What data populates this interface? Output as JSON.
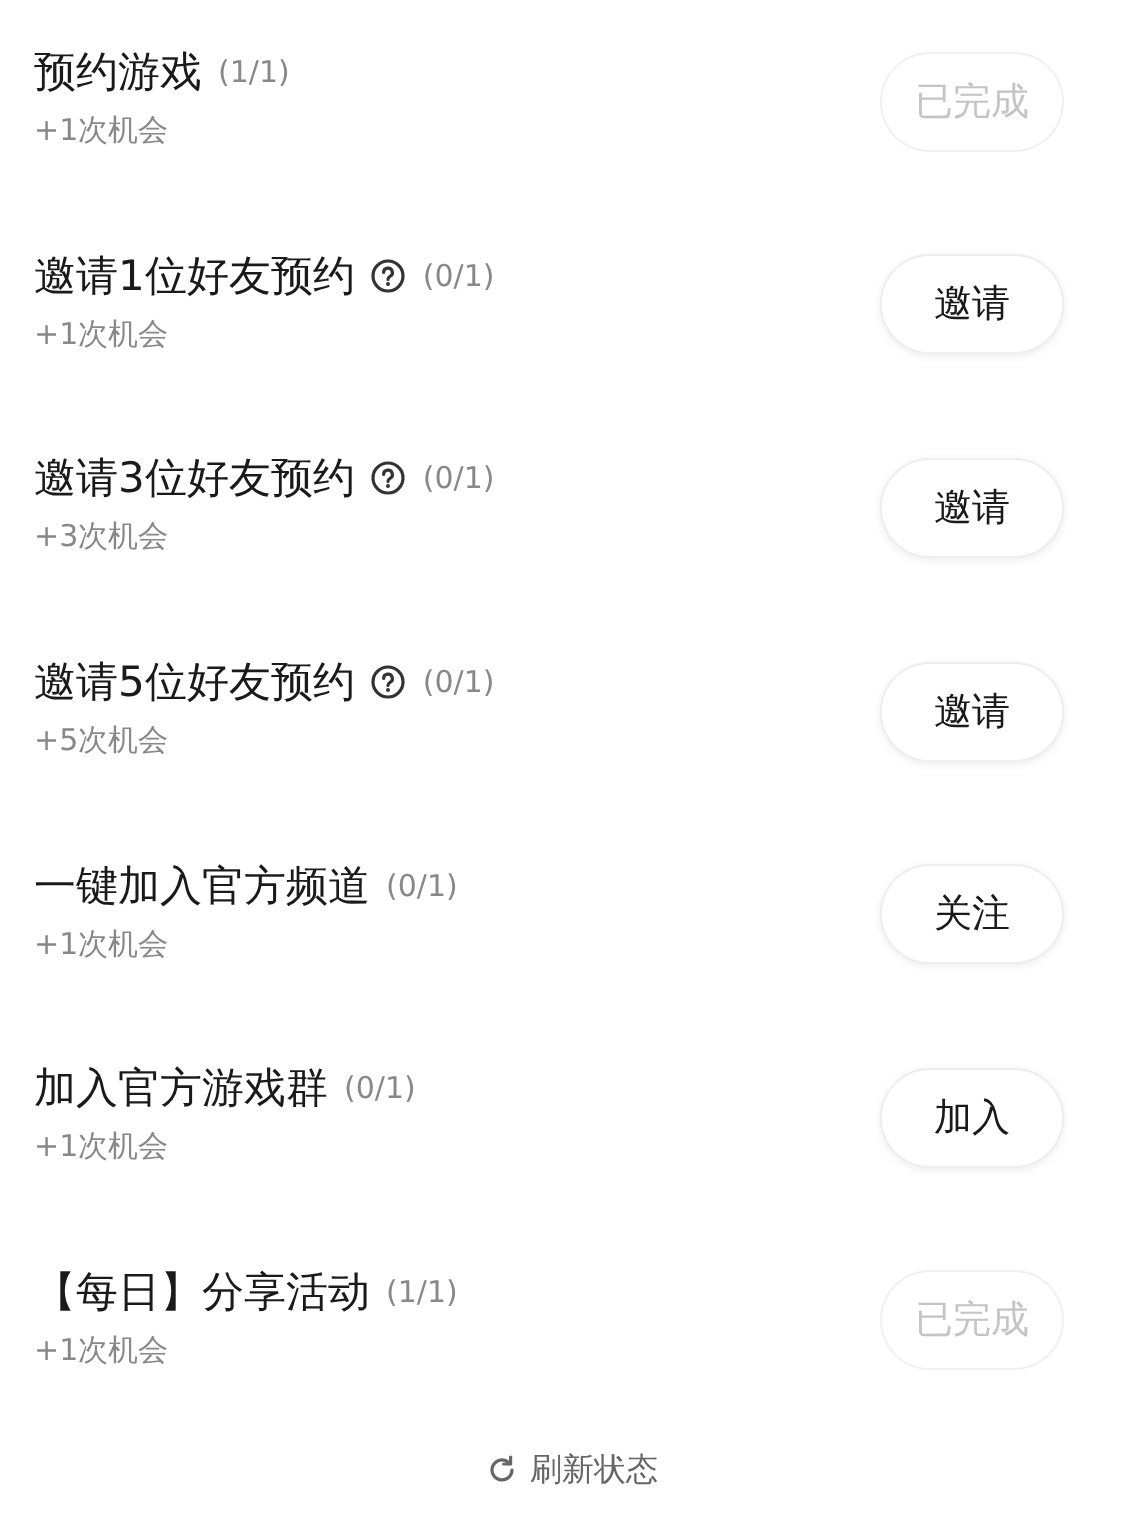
{
  "tasks": [
    {
      "title": "预约游戏",
      "help": false,
      "progress": "(1/1)",
      "reward": "+1次机会",
      "button": {
        "label": "已完成",
        "done": true
      }
    },
    {
      "title": "邀请1位好友预约",
      "help": true,
      "progress": "(0/1)",
      "reward": "+1次机会",
      "button": {
        "label": "邀请",
        "done": false
      }
    },
    {
      "title": "邀请3位好友预约",
      "help": true,
      "progress": "(0/1)",
      "reward": "+3次机会",
      "button": {
        "label": "邀请",
        "done": false
      }
    },
    {
      "title": "邀请5位好友预约",
      "help": true,
      "progress": "(0/1)",
      "reward": "+5次机会",
      "button": {
        "label": "邀请",
        "done": false
      }
    },
    {
      "title": "一键加入官方频道",
      "help": false,
      "progress": "(0/1)",
      "reward": "+1次机会",
      "button": {
        "label": "关注",
        "done": false
      }
    },
    {
      "title": "加入官方游戏群",
      "help": false,
      "progress": "(0/1)",
      "reward": "+1次机会",
      "button": {
        "label": "加入",
        "done": false
      }
    },
    {
      "title": "【每日】分享活动",
      "help": false,
      "progress": "(1/1)",
      "reward": "+1次机会",
      "button": {
        "label": "已完成",
        "done": true
      }
    }
  ],
  "refresh": {
    "label": "刷新状态"
  }
}
